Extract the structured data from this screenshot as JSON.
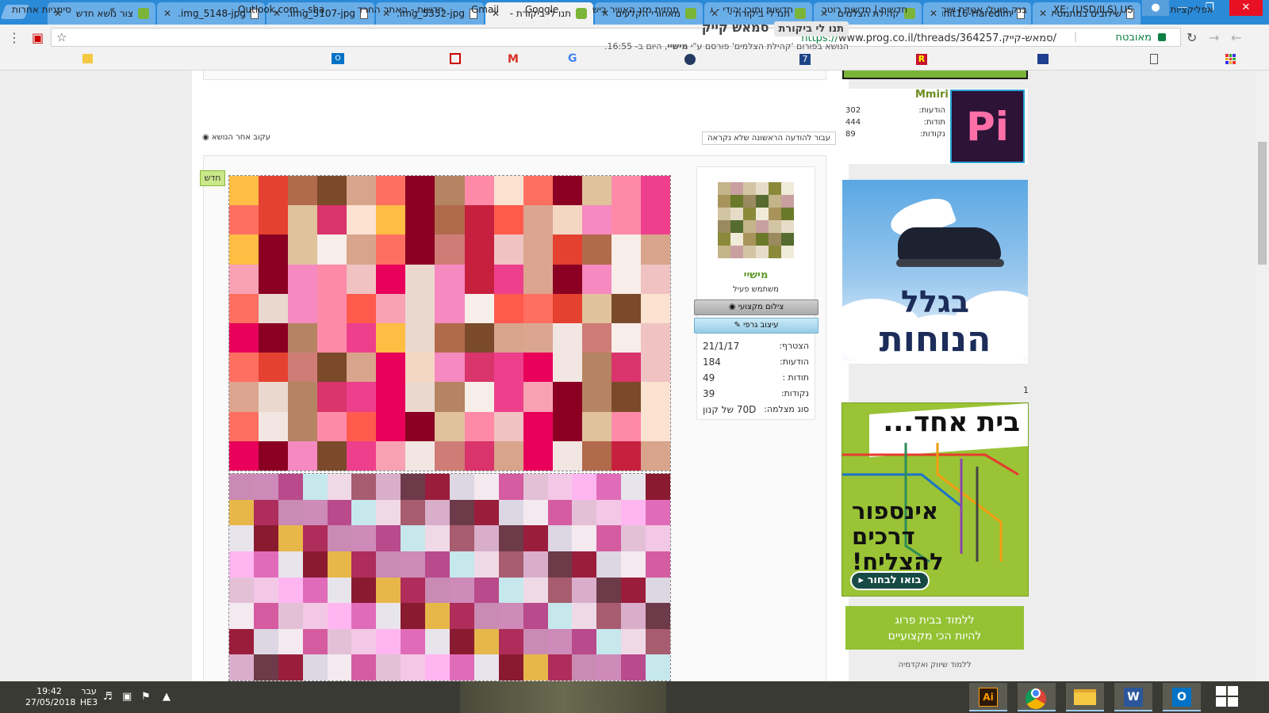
{
  "tabs": [
    {
      "title": "שילובים במתמטיקה",
      "icon": "doc",
      "active": false
    },
    {
      "title": "unit16-Haredim",
      "icon": "doc",
      "active": false
    },
    {
      "title": "קהילת הצלמים",
      "icon": "fav",
      "active": false
    },
    {
      "title": "תנו לי ביקורת -",
      "icon": "fav",
      "active": false
    },
    {
      "title": "מאחורי הקלעים",
      "icon": "fav",
      "active": false
    },
    {
      "title": "תנו לי ביקורת -",
      "icon": "fav",
      "active": true
    },
    {
      "title": "img_5352-jpg.",
      "icon": "doc",
      "active": false
    },
    {
      "title": "img_5107-jpg.",
      "icon": "doc",
      "active": false
    },
    {
      "title": "img_5148-jpg.",
      "icon": "doc",
      "active": false
    },
    {
      "title": "צור נושא חדש",
      "icon": "fav",
      "active": false
    }
  ],
  "address": {
    "secure_label": "מאובטח",
    "scheme": "https://",
    "url": "www.prog.co.il/threads/364257.סמאש-קייק/"
  },
  "bookmarks": [
    "אפליקציות",
    "XE: (USD/ILS) US Dol",
    "בנק פועלי אגודת ישר",
    "חדשות | חדשות רוטר",
    "חדשות ותוכן יהודי - ע",
    "תחזית מזג האוויר ביש",
    "Google",
    "Gmail",
    "חדשות - האתר החרד",
    "Outlook.com - sharv",
    "»",
    "סימניות אחרות"
  ],
  "thread": {
    "prefix": "תנו לי ביקורת",
    "title": "סמאש קייק",
    "meta_prefix": "הנושא בפורום 'קהילת הצלמים' פורסם ע\"י ",
    "meta_author": "מישיי",
    "meta_suffix": ", היום ב- 16:55.",
    "jump_button": "עבור להודעה הראשונה שלא נקראה",
    "follow": "עקוב אחר הנושא",
    "new_badge": "חדש"
  },
  "author": {
    "name": "מישיי",
    "title": "משתמש פעיל",
    "badge1": "צילום מקצועי",
    "badge2": "עיצוב גרפי",
    "stats": [
      {
        "label": "הצטרף:",
        "value": "21/1/17"
      },
      {
        "label": "הודעות:",
        "value": "184"
      },
      {
        "label": "תודות :",
        "value": "49"
      },
      {
        "label": "נקודות:",
        "value": "39"
      },
      {
        "label": "סוג מצלמה:",
        "value": "70D של קנון"
      }
    ]
  },
  "sidebar": {
    "user_name": "Mmiri",
    "stats": [
      {
        "label": "הודעות:",
        "value": "302"
      },
      {
        "label": "תודות:",
        "value": "444"
      },
      {
        "label": "נקודות:",
        "value": "89"
      }
    ],
    "logo_text": "Pi",
    "ad_shoe": {
      "line1": "בגלל",
      "line2": "הנוחות"
    },
    "ad_counter": "1",
    "ad_house": {
      "headline": "בית אחד...",
      "body": "אינספור דרכים להצליח!",
      "cta": "בואו לבחור"
    },
    "ad_study": {
      "line1": "ללמוד בבית פרוג",
      "line2": "להיות הכי מקצועיים",
      "sub": "ללמוד שיווק ואקדמיה"
    }
  },
  "taskbar": {
    "time": "19:42",
    "date": "27/05/2018",
    "lang1": "עבר",
    "lang2": "HE3"
  }
}
